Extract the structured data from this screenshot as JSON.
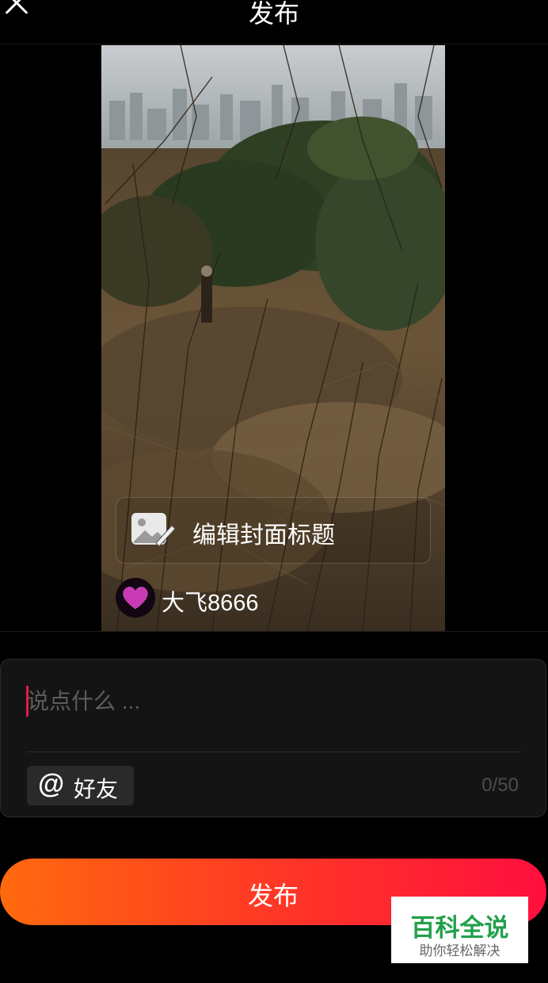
{
  "header": {
    "close_icon": "close-icon",
    "title": "发布"
  },
  "preview": {
    "cover_title_icon": "image-edit-icon",
    "cover_title_label": "编辑封面标题",
    "author_avatar_icon": "heart-avatar",
    "author_name": "大飞8666"
  },
  "compose": {
    "placeholder": "说点什么 ...",
    "value": "",
    "mention_icon": "at-icon",
    "mention_symbol": "@",
    "mention_label": "好友",
    "char_count": "0/50"
  },
  "publish_button": {
    "label": "发布"
  },
  "watermark": {
    "main": "百科全说",
    "sub": "助你轻松解决"
  },
  "colors": {
    "background": "#000000",
    "panel": "#141414",
    "caret": "#e8174a",
    "publish_gradient_start": "#ff6a0e",
    "publish_gradient_end": "#ff0f3e",
    "watermark_green": "#22a04b"
  }
}
